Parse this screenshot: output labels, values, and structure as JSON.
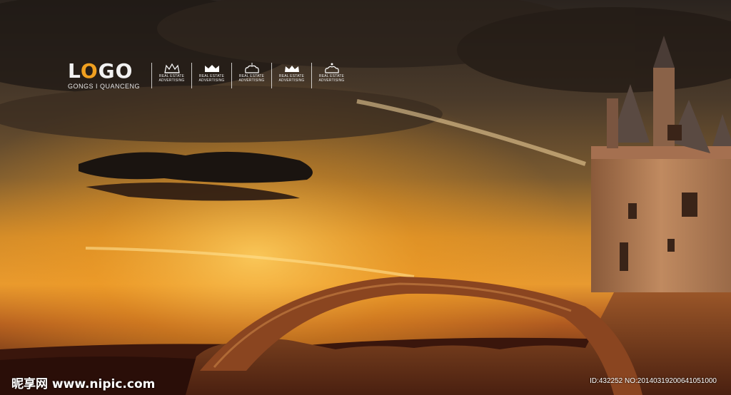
{
  "logo": {
    "wordmark_pre": "L",
    "wordmark_accent": "O",
    "wordmark_post": "GO",
    "tagline": "GONGS I QUANCENG"
  },
  "crown_badges": [
    {
      "icon": "crown-icon",
      "caption_line1": "REAL ESTATE",
      "caption_line2": "ADVERTISING"
    },
    {
      "icon": "crown-icon",
      "caption_line1": "REAL ESTATE",
      "caption_line2": "ADVERTISING"
    },
    {
      "icon": "crown-icon",
      "caption_line1": "REAL ESTATE",
      "caption_line2": "ADVERTISING"
    },
    {
      "icon": "crown-icon",
      "caption_line1": "REAL ESTATE",
      "caption_line2": "ADVERTISING"
    },
    {
      "icon": "crown-icon",
      "caption_line1": "REAL ESTATE",
      "caption_line2": "ADVERTISING"
    }
  ],
  "watermark": {
    "site": "昵享网 www.nipic.com",
    "id_text": "ID:432252 NO:20140319200641051000"
  },
  "colors": {
    "sky_dark": "#2a2018",
    "sunset_glow": "#f0a020",
    "rock": "#8a4a22",
    "castle_stone": "#b07a55"
  }
}
